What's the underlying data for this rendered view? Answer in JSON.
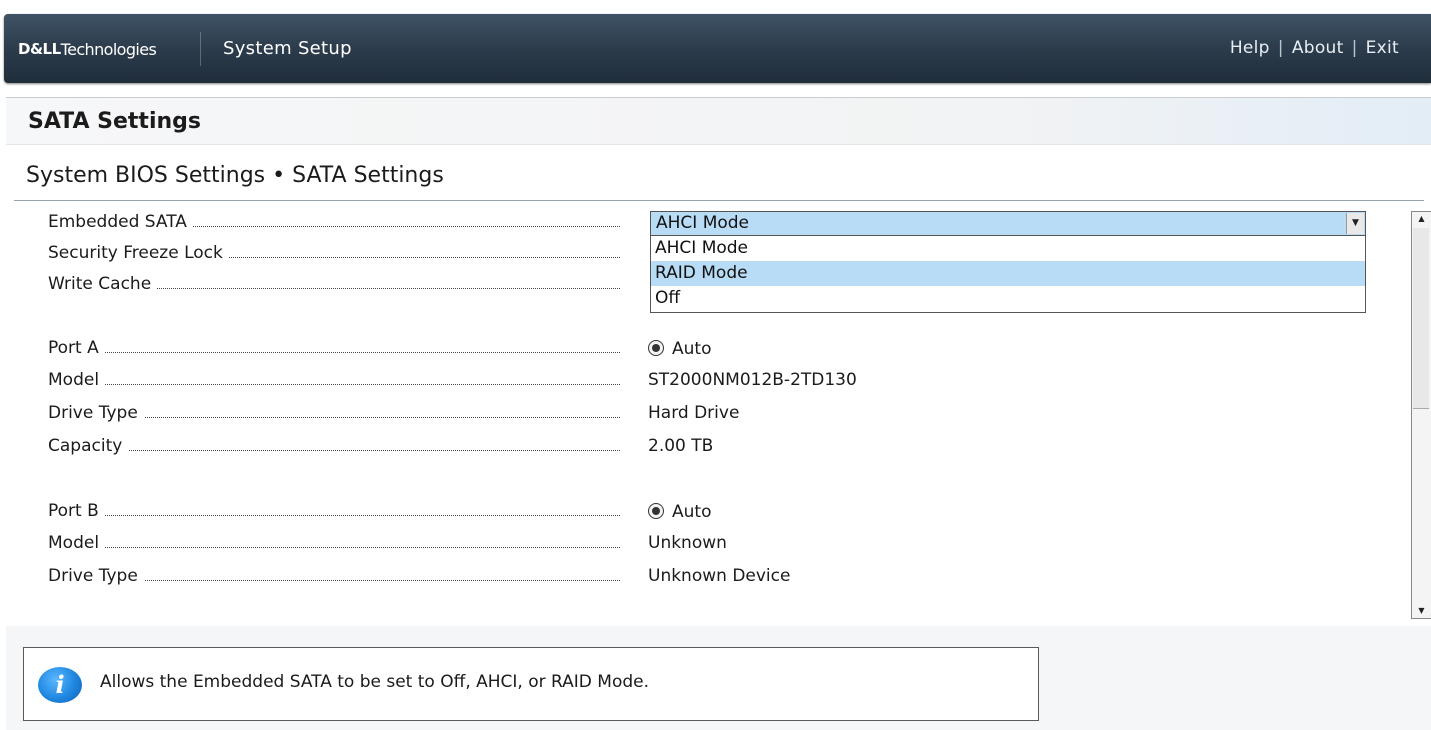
{
  "header": {
    "brand_dell": "D&LL",
    "brand_technologies": "Technologies",
    "title": "System Setup",
    "links": [
      "Help",
      "About",
      "Exit"
    ],
    "link_separator": "|"
  },
  "page": {
    "title": "SATA Settings",
    "breadcrumb": "System BIOS Settings • SATA Settings"
  },
  "settings": {
    "embedded_sata": {
      "label": "Embedded SATA",
      "selected": "AHCI Mode",
      "options": [
        "AHCI Mode",
        "RAID Mode",
        "Off"
      ],
      "highlighted": "RAID Mode"
    },
    "security_freeze_lock": {
      "label": "Security Freeze Lock"
    },
    "write_cache": {
      "label": "Write Cache"
    }
  },
  "ports": [
    {
      "port_label": "Port A",
      "port_value": "Auto",
      "model_label": "Model",
      "model_value": "ST2000NM012B-2TD130",
      "drive_type_label": "Drive Type",
      "drive_type_value": "Hard Drive",
      "capacity_label": "Capacity",
      "capacity_value": "2.00 TB"
    },
    {
      "port_label": "Port B",
      "port_value": "Auto",
      "model_label": "Model",
      "model_value": "Unknown",
      "drive_type_label": "Drive Type",
      "drive_type_value": "Unknown Device"
    }
  ],
  "help": {
    "icon": "info-icon",
    "glyph": "i",
    "text": "Allows the Embedded SATA to be set to Off, AHCI, or RAID Mode."
  },
  "colors": {
    "header_bg": "#2c3c4c",
    "selection": "#b9dcf6",
    "info_icon": "#1f86e0"
  }
}
